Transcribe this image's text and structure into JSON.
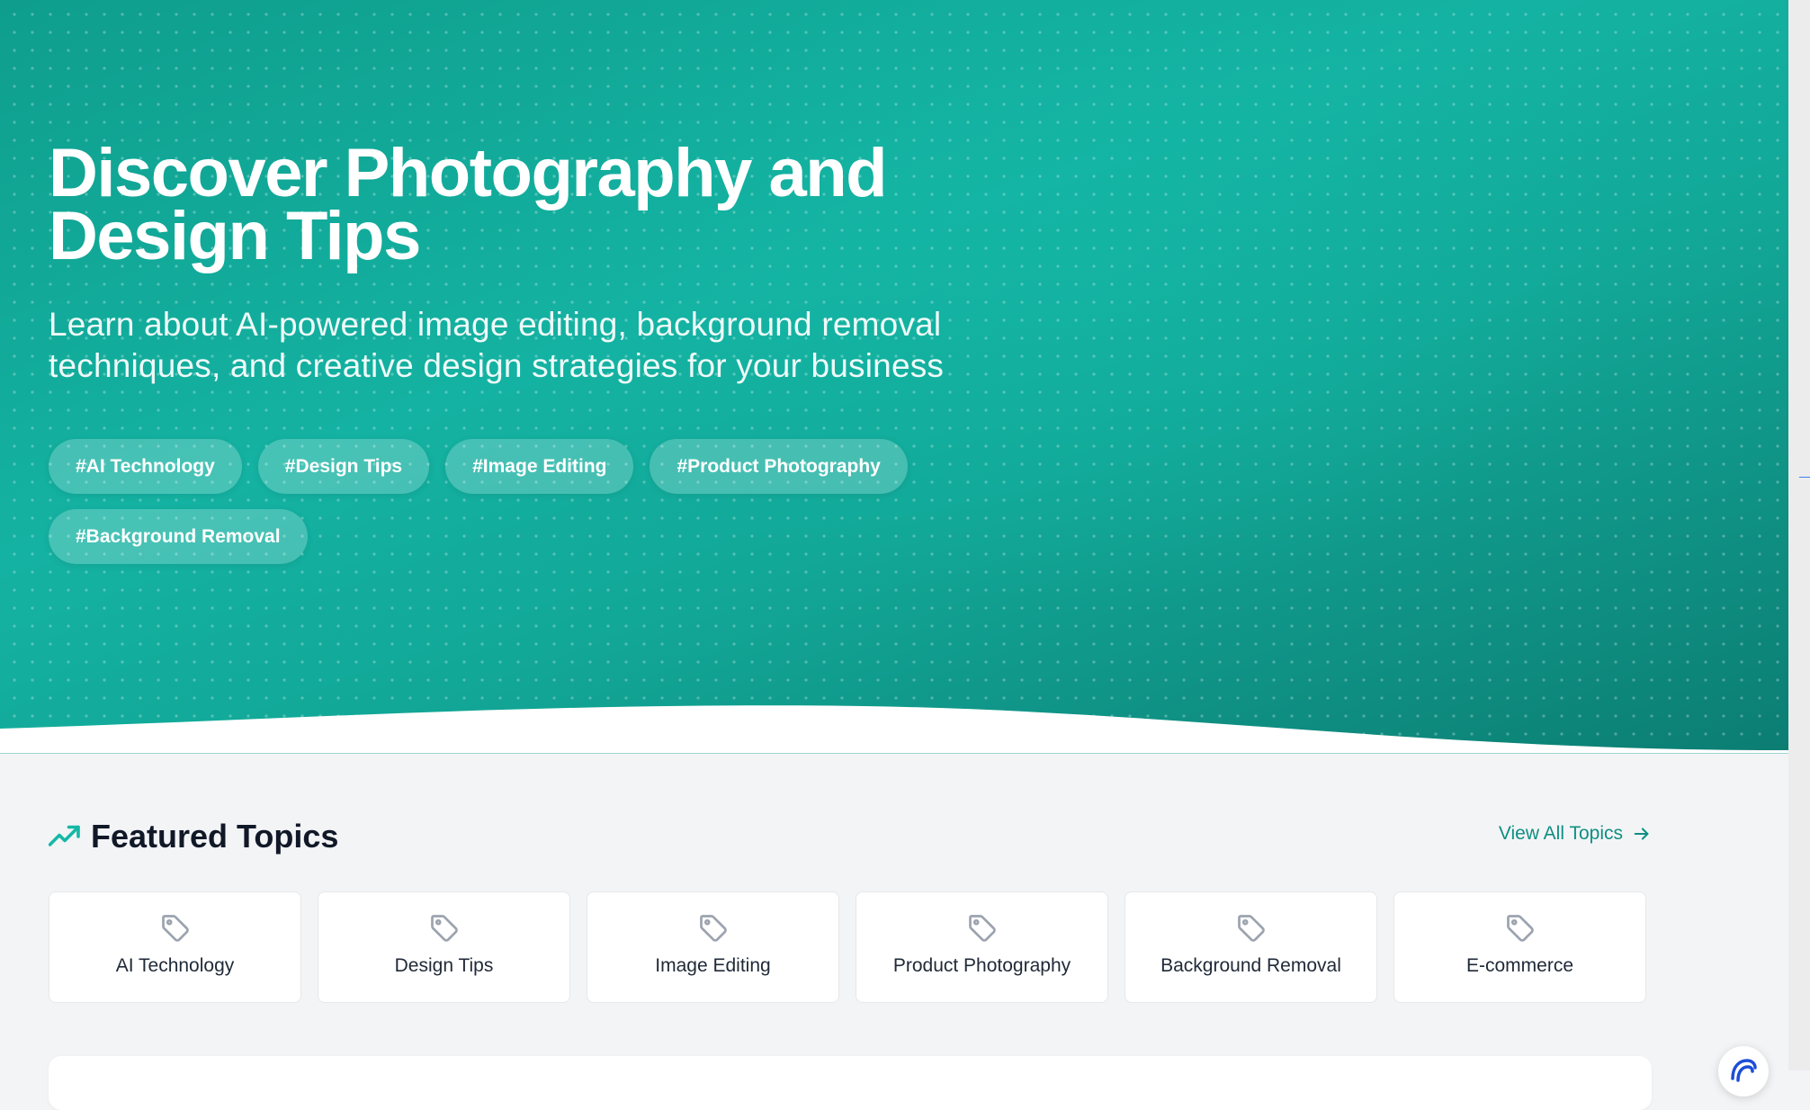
{
  "hero": {
    "title": "Discover Photography and Design Tips",
    "subtitle": "Learn about AI-powered image editing, background removal techniques, and creative design strategies for your business",
    "tags": [
      "#AI Technology",
      "#Design Tips",
      "#Image Editing",
      "#Product Photography",
      "#Background Removal"
    ]
  },
  "featured": {
    "icon": "trending-up-icon",
    "title": "Featured Topics",
    "view_all": "View All Topics",
    "view_all_icon": "arrow-right-icon",
    "topic_icon": "tag-icon",
    "topics": [
      "AI Technology",
      "Design Tips",
      "Image Editing",
      "Product Photography",
      "Background Removal",
      "E-commerce"
    ]
  },
  "colors": {
    "accent": "#14b8a6",
    "accent_dark": "#0f8f82",
    "heading": "#111827",
    "background": "#f3f4f6"
  }
}
